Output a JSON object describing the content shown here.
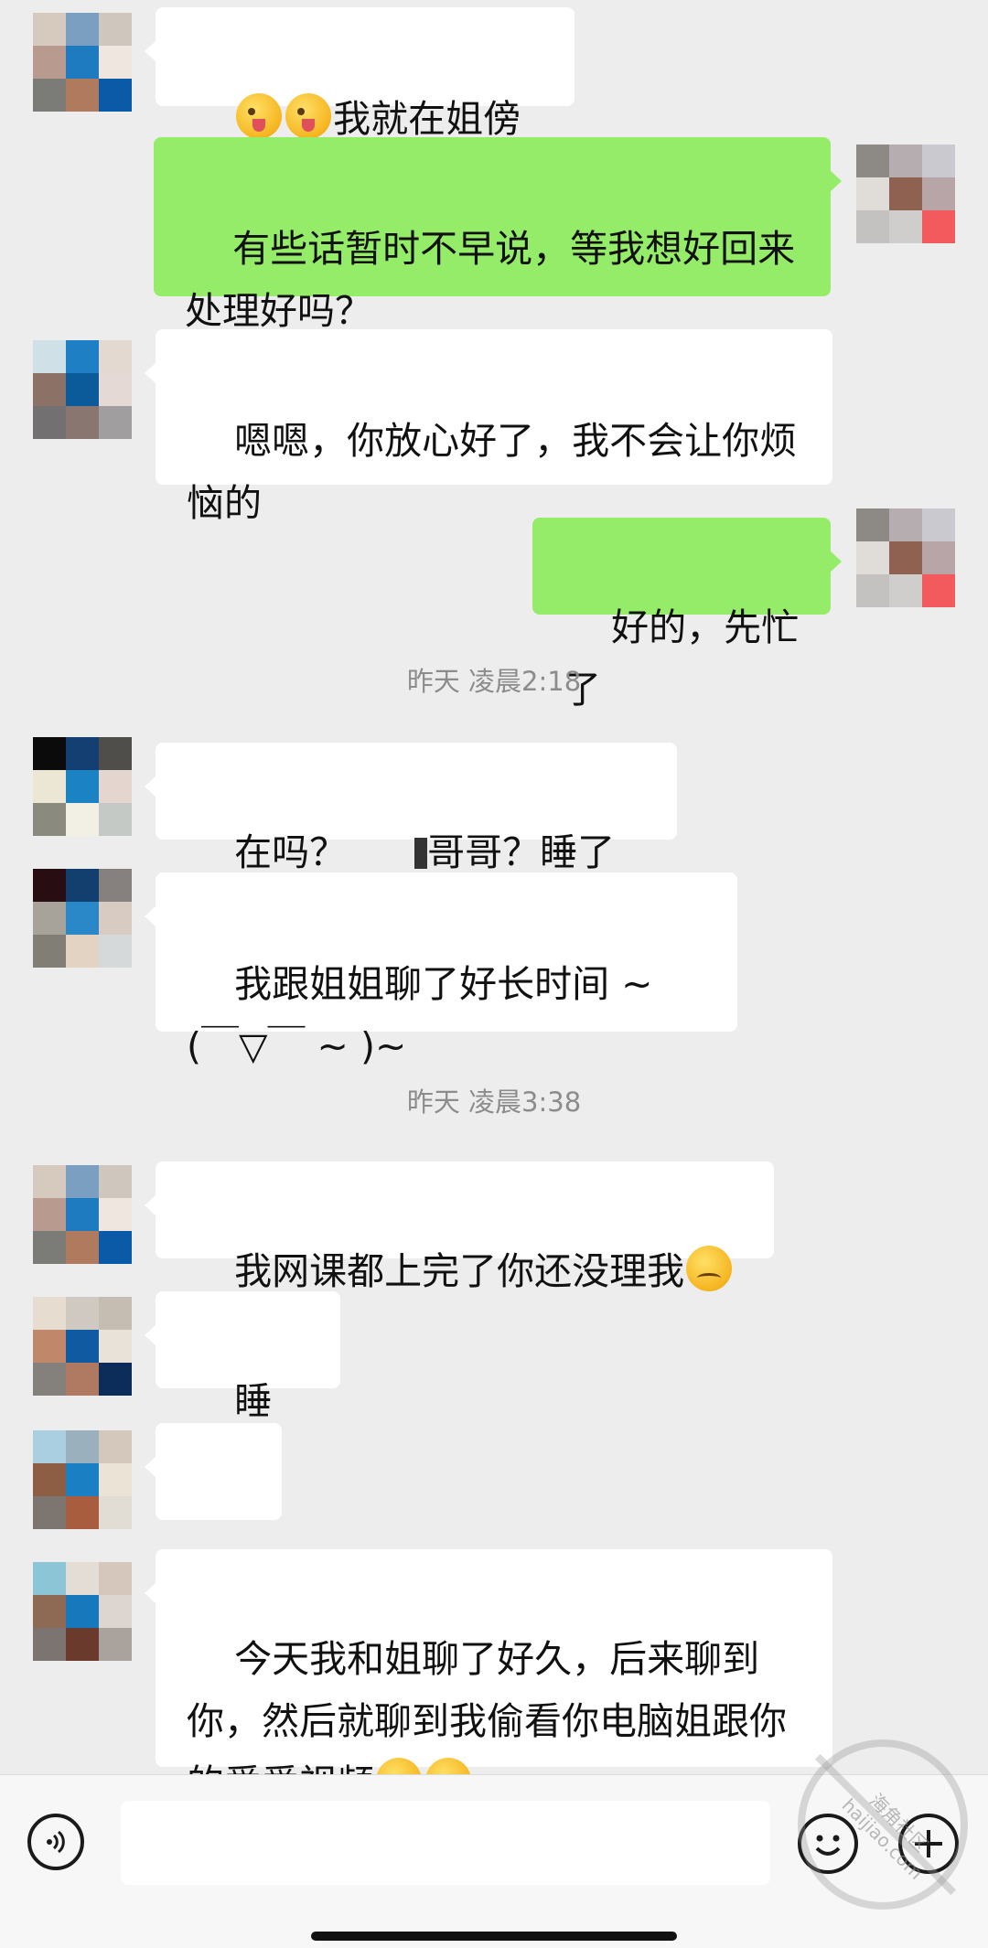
{
  "messages": [
    {
      "side": "left",
      "text": "我就在姐傍边",
      "prefix_emoji": [
        "wink-tongue-emoji",
        "wink-tongue-emoji"
      ]
    },
    {
      "side": "right",
      "text": "有些话暂时不早说，等我想好回来处理好吗？"
    },
    {
      "side": "left",
      "text": "嗯嗯，你放心好了，我不会让你烦恼的"
    },
    {
      "side": "right",
      "text": "好的，先忙了"
    },
    {
      "side": "timestamp",
      "text": "昨天 凌晨2:18"
    },
    {
      "side": "left",
      "text_a": "在吗？",
      "text_b": "哥哥？睡了没？"
    },
    {
      "side": "left",
      "text": "我跟姐姐聊了好长时间 ~ (￣▽￣ ~ )~"
    },
    {
      "side": "timestamp",
      "text": "昨天 凌晨3:38"
    },
    {
      "side": "left",
      "text": "我网课都上完了你还没理我",
      "suffix_emoji": [
        "frown-emoji"
      ]
    },
    {
      "side": "left",
      "text": "睡着了"
    },
    {
      "side": "left",
      "text": "???"
    },
    {
      "side": "left",
      "text": "今天我和姐聊了好久，后来聊到你，然后就聊到我偷看你电脑姐跟你的爱爱视频",
      "suffix_emoji": [
        "thinking-emoji",
        "thinking-emoji"
      ]
    }
  ],
  "input_bar": {
    "placeholder": "",
    "voice_icon": "voice-icon",
    "emoji_icon": "emoji-face-icon",
    "plus_icon": "plus-icon"
  },
  "watermark": {
    "text": "海角社区 haijiao.com"
  },
  "colors": {
    "background": "#ededed",
    "bubble_left": "#ffffff",
    "bubble_right": "#95ec69",
    "timestamp": "#8c8c8c"
  }
}
